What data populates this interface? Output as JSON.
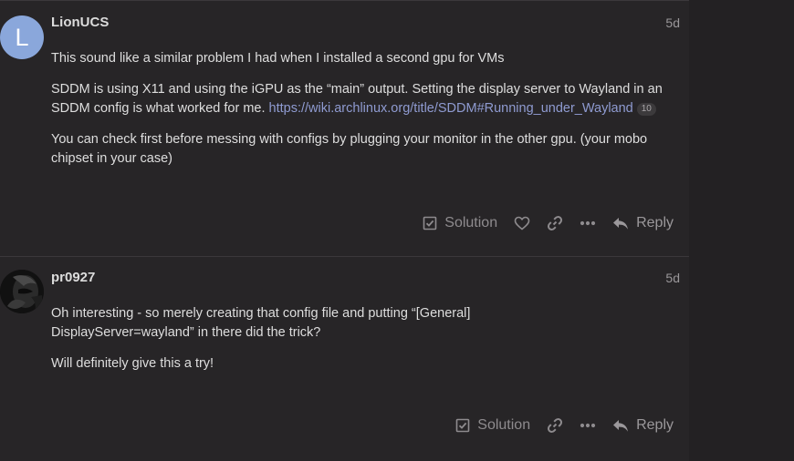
{
  "posts": [
    {
      "avatar_letter": "L",
      "avatar_color": "#8aa7db",
      "username": "LionUCS",
      "date": "5d",
      "paragraphs": [
        "This sound like a similar problem I had when I installed a second gpu for VMs",
        "SDDM is using X11 and using the iGPU as the “main” output. Setting the display server to Wayland in an SDDM config is what worked for me.",
        "You can check first before messing with configs by plugging your monitor in the other gpu. (your mobo chipset in your case)"
      ],
      "link_text": "https://wiki.archlinux.org/title/SDDM#Running_under_Wayland",
      "link_clicks": "10",
      "actions": {
        "solution_label": "Solution",
        "reply_label": "Reply"
      }
    },
    {
      "username": "pr0927",
      "date": "5d",
      "paragraphs": [
        "Oh interesting - so merely creating that config file and putting “[General]",
        "DisplayServer=wayland” in there did the trick?",
        "Will definitely give this a try!"
      ],
      "actions": {
        "solution_label": "Solution",
        "reply_label": "Reply"
      }
    }
  ],
  "colors": {
    "background": "#232123",
    "post_background": "#272527",
    "link": "#8f9bd1",
    "muted": "#8e8b8e"
  },
  "icons": [
    "checkbox-icon",
    "heart-icon",
    "link-icon",
    "more-icon",
    "reply-icon"
  ]
}
